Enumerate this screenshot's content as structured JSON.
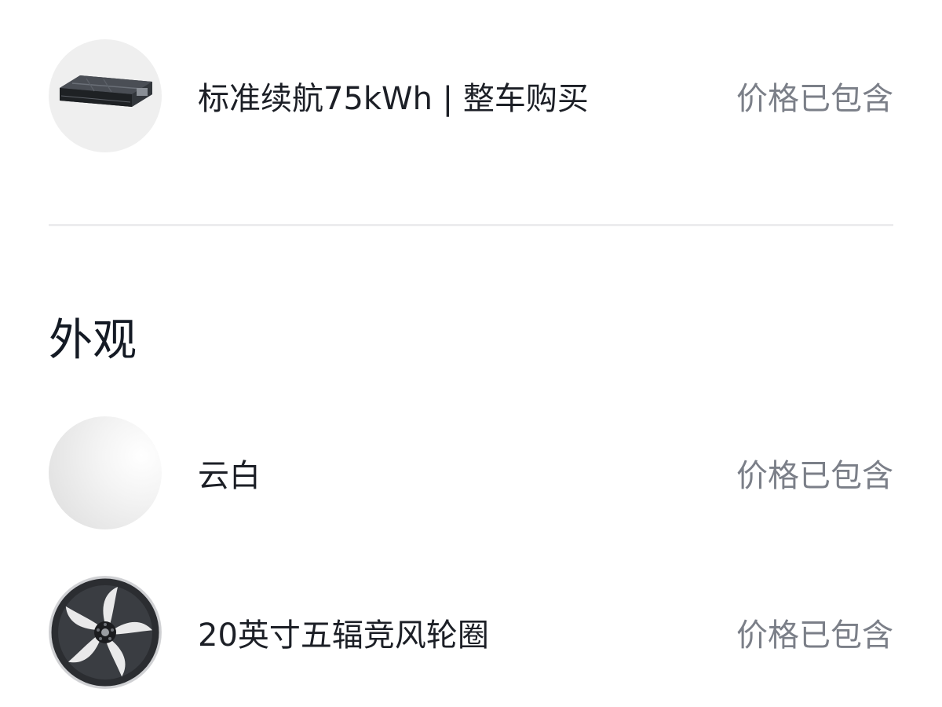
{
  "battery": {
    "name": "标准续航75kWh | 整车购买",
    "price": "价格已包含",
    "icon": "battery-pack-icon"
  },
  "exterior": {
    "title": "外观",
    "items": [
      {
        "name": "云白",
        "price": "价格已包含",
        "icon": "white-color-swatch-icon",
        "color": "#f2f2f2"
      },
      {
        "name": "20英寸五辐竞风轮圈",
        "price": "价格已包含",
        "icon": "wheel-icon"
      }
    ]
  },
  "colors": {
    "text_primary": "#1c1f26",
    "text_secondary": "#7b7f88",
    "divider": "#ececee"
  }
}
